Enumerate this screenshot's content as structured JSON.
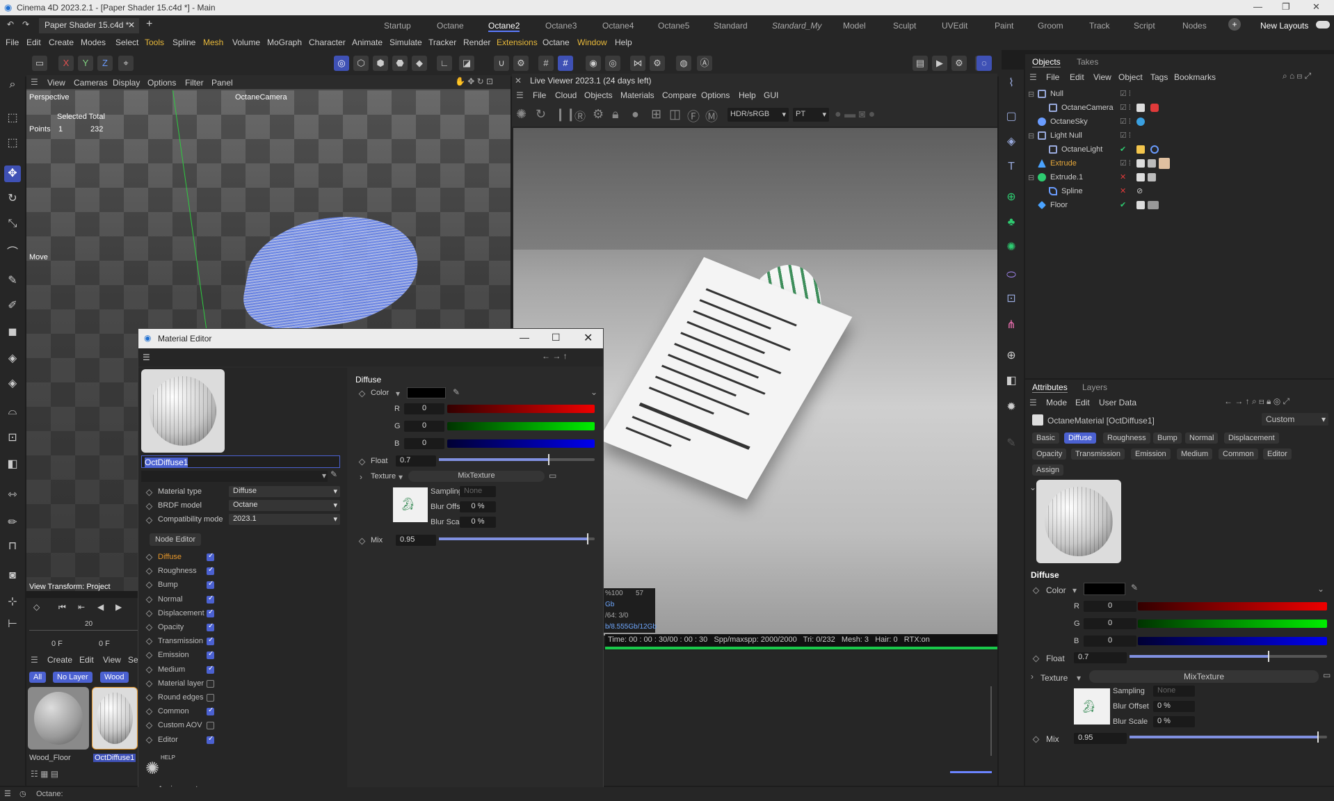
{
  "window": {
    "title": "Cinema 4D 2023.2.1 - [Paper Shader 15.c4d *] - Main"
  },
  "doc_tab": "Paper Shader 15.c4d *",
  "layout_tabs": [
    "Startup",
    "Octane",
    "Octane2",
    "Octane3",
    "Octane4",
    "Octane5",
    "Standard",
    "Standard_My",
    "Model",
    "Sculpt",
    "UVEdit",
    "Paint",
    "Groom",
    "Track",
    "Script",
    "Nodes"
  ],
  "layout_active": "Octane2",
  "new_layouts": "New Layouts",
  "menu": [
    "File",
    "Edit",
    "Create",
    "Modes",
    "Select",
    "Tools",
    "Spline",
    "Mesh",
    "Volume",
    "MoGraph",
    "Character",
    "Animate",
    "Simulate",
    "Tracker",
    "Render",
    "Extensions",
    "Octane",
    "Window",
    "Help"
  ],
  "axes": [
    "X",
    "Y",
    "Z"
  ],
  "viewport": {
    "menu": [
      "View",
      "Cameras",
      "Display",
      "Options",
      "Filter",
      "Panel"
    ],
    "label": "Perspective",
    "camera": "OctaneCamera",
    "selected_total": "Selected Total",
    "points_label": "Points",
    "points_a": "1",
    "points_b": "232",
    "move": "Move",
    "view_transform": "View Transform: Project"
  },
  "timeline": {
    "mark": "20",
    "frame_a": "0 F",
    "frame_b": "0 F"
  },
  "matmgr": {
    "menu": [
      "Create",
      "Edit",
      "View",
      "Se"
    ],
    "filters": [
      "All",
      "No Layer",
      "Wood"
    ],
    "materials": [
      "Wood_Floor",
      "OctDiffuse1"
    ]
  },
  "liveviewer": {
    "title": "Live Viewer 2023.1 (24 days left)",
    "menu": [
      "File",
      "Cloud",
      "Objects",
      "Materials",
      "Compare",
      "Options",
      "Help",
      "GUI"
    ],
    "color_mode": "HDR/sRGB",
    "kernel": "PT",
    "stats": [
      "%100",
      "57",
      "Gb",
      "/64: 3/0",
      "b/8.555Gb/12Gb"
    ],
    "status": "Time: 00 : 00 : 30/00 : 00 : 30   Spp/maxspp: 2000/2000   Tri: 0/232   Mesh: 3   Hair: 0   RTX:on"
  },
  "material_editor": {
    "title": "Material Editor",
    "name": "OctDiffuse1",
    "material_type_label": "Material type",
    "material_type": "Diffuse",
    "brdf_label": "BRDF model",
    "brdf": "Octane",
    "compat_label": "Compatibility mode",
    "compat": "2023.1",
    "node_editor": "Node Editor",
    "channels": [
      {
        "name": "Diffuse",
        "on": true,
        "active": true
      },
      {
        "name": "Roughness",
        "on": true
      },
      {
        "name": "Bump",
        "on": true
      },
      {
        "name": "Normal",
        "on": true
      },
      {
        "name": "Displacement",
        "on": true
      },
      {
        "name": "Opacity",
        "on": true
      },
      {
        "name": "Transmission",
        "on": true
      },
      {
        "name": "Emission",
        "on": true
      },
      {
        "name": "Medium",
        "on": true
      },
      {
        "name": "Material layer",
        "on": false
      },
      {
        "name": "Round edges",
        "on": false
      },
      {
        "name": "Common",
        "on": true
      },
      {
        "name": "Custom AOV",
        "on": false
      },
      {
        "name": "Editor",
        "on": true
      }
    ],
    "help": "HELP",
    "assignment": "Assignment",
    "section": "Diffuse",
    "color_label": "Color",
    "r_label": "R",
    "g_label": "G",
    "b_label": "B",
    "r": "0",
    "g": "0",
    "b": "0",
    "float_label": "Float",
    "float": "0.7",
    "texture_label": "Texture",
    "texture": "MixTexture",
    "sampling_label": "Sampling",
    "sampling": "None",
    "blur_offset_label": "Blur Offset",
    "blur_offset": "0 %",
    "blur_scale_label": "Blur Scale",
    "blur_scale": "0 %",
    "mix_label": "Mix",
    "mix": "0.95"
  },
  "objects": {
    "tabs": [
      "Objects",
      "Takes"
    ],
    "menu": [
      "File",
      "Edit",
      "View",
      "Object",
      "Tags",
      "Bookmarks"
    ],
    "items": [
      "Null",
      "OctaneCamera",
      "OctaneSky",
      "Light Null",
      "OctaneLight",
      "Extrude",
      "Extrude.1",
      "Spline",
      "Floor"
    ]
  },
  "attributes": {
    "tabs": [
      "Attributes",
      "Layers"
    ],
    "menu": [
      "Mode",
      "Edit",
      "User Data"
    ],
    "header": "OctaneMaterial [OctDiffuse1]",
    "preset": "Custom",
    "subtabs": [
      "Basic",
      "Diffuse",
      "Roughness",
      "Bump",
      "Normal",
      "Displacement",
      "Opacity",
      "Transmission",
      "Emission",
      "Medium",
      "Common",
      "Editor",
      "Assign"
    ],
    "active_subtab": "Diffuse"
  },
  "status": "Octane:",
  "colors": {
    "accent": "#4b61d1",
    "highlight": "#e8982a",
    "green": "#19c94a"
  }
}
